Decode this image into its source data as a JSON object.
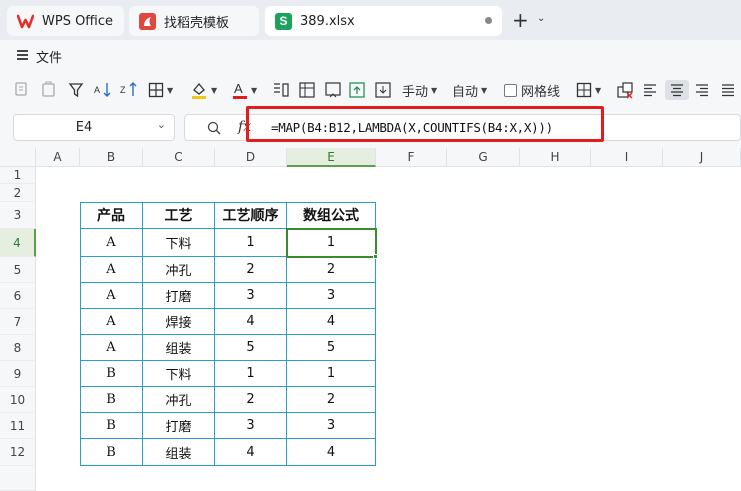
{
  "tabs": [
    {
      "label": "WPS Office",
      "icon": "wps-logo-icon"
    },
    {
      "label": "找稻壳模板",
      "icon": "daoke-logo-icon"
    },
    {
      "label": "389.xlsx",
      "icon": "spreadsheet-icon",
      "icon_letter": "S",
      "active": true
    }
  ],
  "new_tab": "+",
  "menu": {
    "file_label": "文件"
  },
  "toolbar": {
    "fill_color": "#f5c518",
    "font_color": "#e51c1c",
    "manual_label": "手动",
    "auto_label": "自动",
    "gridlines_label": "网格线"
  },
  "formula_bar": {
    "cell_ref": "E4",
    "fx": "fx",
    "formula": "=MAP(B4:B12,LAMBDA(X,COUNTIFS(B4:X,X)))"
  },
  "sheet": {
    "columns": [
      "A",
      "B",
      "C",
      "D",
      "E",
      "F",
      "G",
      "H",
      "I",
      "J"
    ],
    "rows": [
      "1",
      "2",
      "3",
      "4",
      "5",
      "6",
      "7",
      "8",
      "9",
      "10",
      "11",
      "12"
    ],
    "selected_column": "E",
    "selected_row": "4",
    "table_headers": [
      "产品",
      "工艺",
      "工艺顺序",
      "数组公式"
    ],
    "table_rows": [
      [
        "A",
        "下料",
        "1",
        "1"
      ],
      [
        "A",
        "冲孔",
        "2",
        "2"
      ],
      [
        "A",
        "打磨",
        "3",
        "3"
      ],
      [
        "A",
        "焊接",
        "4",
        "4"
      ],
      [
        "A",
        "组装",
        "5",
        "5"
      ],
      [
        "B",
        "下料",
        "1",
        "1"
      ],
      [
        "B",
        "冲孔",
        "2",
        "2"
      ],
      [
        "B",
        "打磨",
        "3",
        "3"
      ],
      [
        "B",
        "组装",
        "4",
        "4"
      ]
    ],
    "table_border_color": "#2a9fc9",
    "selection_color": "#3b8a2e"
  }
}
